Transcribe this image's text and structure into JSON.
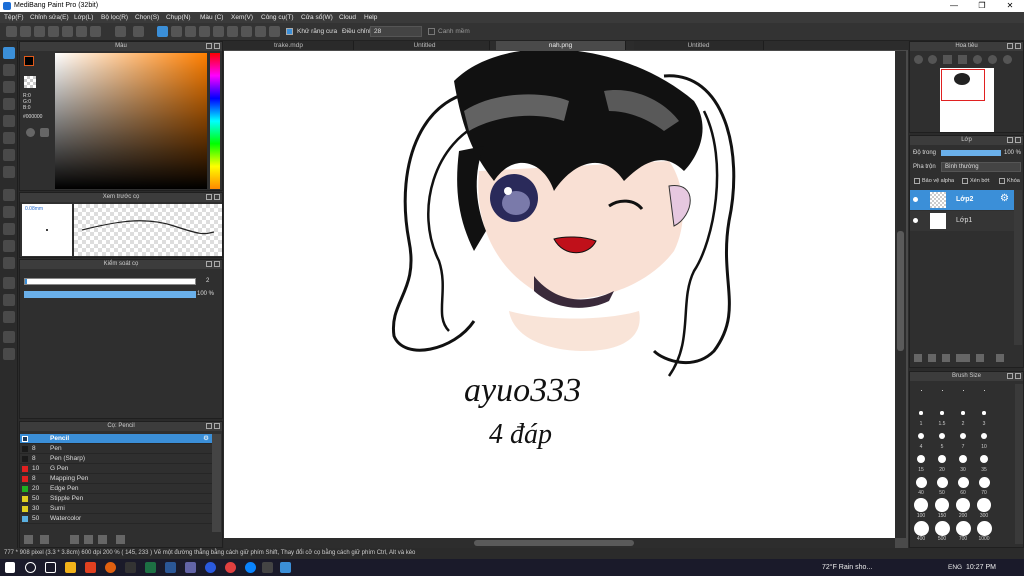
{
  "window": {
    "title": "MediBang Paint Pro (32bit)",
    "controls": [
      "—",
      "❐",
      "✕"
    ]
  },
  "menu": [
    "Tệp(F)",
    "Chỉnh sửa(E)",
    "Lớp(L)",
    "Bộ lọc(R)",
    "Chọn(S)",
    "Chụp(N)",
    "Màu (C)",
    "Xem(V)",
    "Công cụ(T)",
    "Cửa sổ(W)",
    "Cloud",
    "Help"
  ],
  "toolbar": {
    "antialias": "Khử răng cưa",
    "correction_label": "Điều chỉnh",
    "correction_value": "28",
    "soft_edge": "Canh mềm"
  },
  "color_panel": {
    "title": "Màu",
    "r": "R:0",
    "g": "G:0",
    "b": "B:0",
    "hex": "#000000"
  },
  "brush_preview": {
    "title": "Xem trước cọ",
    "size": "0.08mm"
  },
  "brush_control": {
    "title": "Kiểm soát cọ",
    "size_value": "2",
    "opacity_value": "100 %"
  },
  "brush_list": {
    "title": "Cọ: Pencil",
    "items": [
      {
        "size": "",
        "name": "Pencil",
        "color": "#1e3a5a"
      },
      {
        "size": "8",
        "name": "Pen",
        "color": "#1a1a1a"
      },
      {
        "size": "8",
        "name": "Pen (Sharp)",
        "color": "#1a1a1a"
      },
      {
        "size": "10",
        "name": "G Pen",
        "color": "#e02020"
      },
      {
        "size": "8",
        "name": "Mapping Pen",
        "color": "#e02020"
      },
      {
        "size": "20",
        "name": "Edge Pen",
        "color": "#20b020"
      },
      {
        "size": "50",
        "name": "Stipple Pen",
        "color": "#e0d020"
      },
      {
        "size": "30",
        "name": "Sumi",
        "color": "#e0d020"
      },
      {
        "size": "50",
        "name": "Watercolor",
        "color": "#5ab0e0"
      }
    ]
  },
  "tabs": [
    "trake.mdp",
    "Untitled",
    "nah.png",
    "Untitled"
  ],
  "canvas": {
    "signature_line1": "ayuo333",
    "signature_line2": "4 đáp"
  },
  "navigator": {
    "title": "Hoa tiêu"
  },
  "layers": {
    "title": "Lớp",
    "opacity_label": "Độ trong",
    "opacity_value": "100 %",
    "blend_label": "Pha trộn",
    "blend_value": "Bình thường",
    "protect_alpha": "Bảo vệ alpha",
    "clip": "Xén bớt",
    "lock": "Khóa",
    "items": [
      {
        "name": "Lớp2"
      },
      {
        "name": "Lớp1"
      }
    ]
  },
  "brush_size": {
    "title": "Brush Size",
    "labels": [
      "",
      "",
      "",
      "",
      "1",
      "1.5",
      "2",
      "3",
      "4",
      "5",
      "7",
      "10",
      "15",
      "20",
      "30",
      "35",
      "40",
      "50",
      "60",
      "70",
      "100",
      "150",
      "200",
      "300",
      "400",
      "500",
      "700",
      "1000"
    ]
  },
  "status": {
    "text": "777 * 908 pixel  (3.3 * 3.8cm)  600 dpi  200 %  ( 145, 233 )  Vẽ một đường thẳng bằng cách giữ phím Shift, Thay đổi cỡ cọ bằng cách giữ phím Ctrl, Alt và kéo"
  },
  "taskbar": {
    "weather": "72°F  Rain sho...",
    "lang": "ENG",
    "time": "10:27 PM"
  }
}
